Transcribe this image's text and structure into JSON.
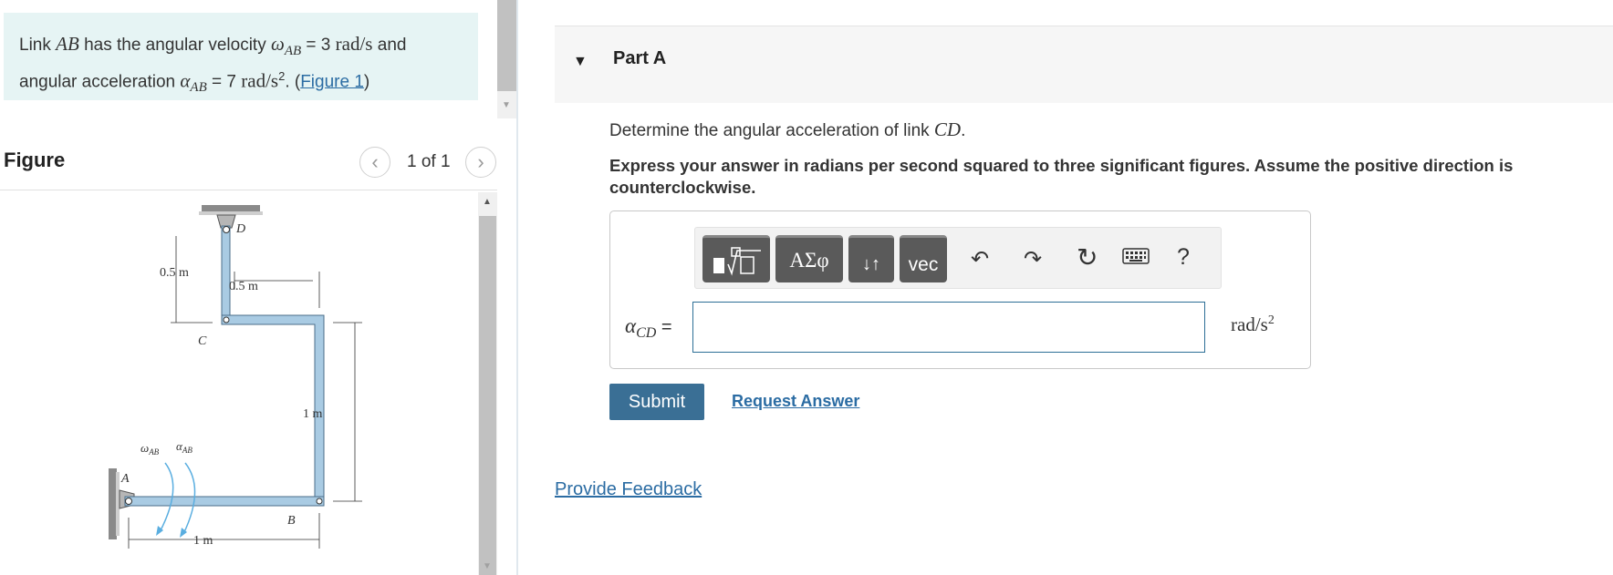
{
  "problem": {
    "t1": "Link ",
    "m_ab": "AB",
    "t2": " has the angular velocity ",
    "omega_sym": "ω",
    "omega_sub": "AB",
    "t3": " = 3 ",
    "omega_unit": "rad/s",
    "t4": " and",
    "t5": "angular acceleration ",
    "alpha_sym": "α",
    "alpha_sub": "AB",
    "t6": " = 7 ",
    "alpha_unit": "rad/s",
    "alpha_unit_exp": "2",
    "t7": ". (",
    "figure_link": "Figure 1",
    "t8": ")"
  },
  "figure": {
    "title": "Figure",
    "prev_icon": "chevron-left-icon",
    "next_icon": "chevron-right-icon",
    "counter": "1 of 1",
    "labels": {
      "D": "D",
      "C": "C",
      "A": "A",
      "B": "B",
      "dim_left": "0.5 m",
      "dim_top": "0.5 m",
      "dim_right": "1 m",
      "dim_bottom": "1 m",
      "omega": "ω",
      "omega_sub": "AB",
      "alpha": "α",
      "alpha_sub": "AB"
    }
  },
  "part": {
    "label": "Part A",
    "question_t1": "Determine the angular acceleration of link ",
    "question_math": "CD",
    "question_t2": ".",
    "instructions": "Express your answer in radians per second squared to three significant figures. Assume the positive direction is counterclockwise.",
    "toolbar": {
      "greek": "ΑΣφ",
      "arrows": "↓↑",
      "vec": "vec",
      "help": "?"
    },
    "var_sym": "α",
    "var_sub": "CD",
    "var_eq": " =",
    "answer_value": "",
    "unit": "rad/s",
    "unit_exp": "2",
    "submit": "Submit",
    "request": "Request Answer"
  },
  "feedback": "Provide Feedback",
  "colors": {
    "link_blue": "#2b6ca3",
    "submit_bg": "#3a6f95",
    "problem_bg": "#e6f4f4",
    "link_fill": "#a9cbe3",
    "arrow_blue": "#5aaee0"
  }
}
